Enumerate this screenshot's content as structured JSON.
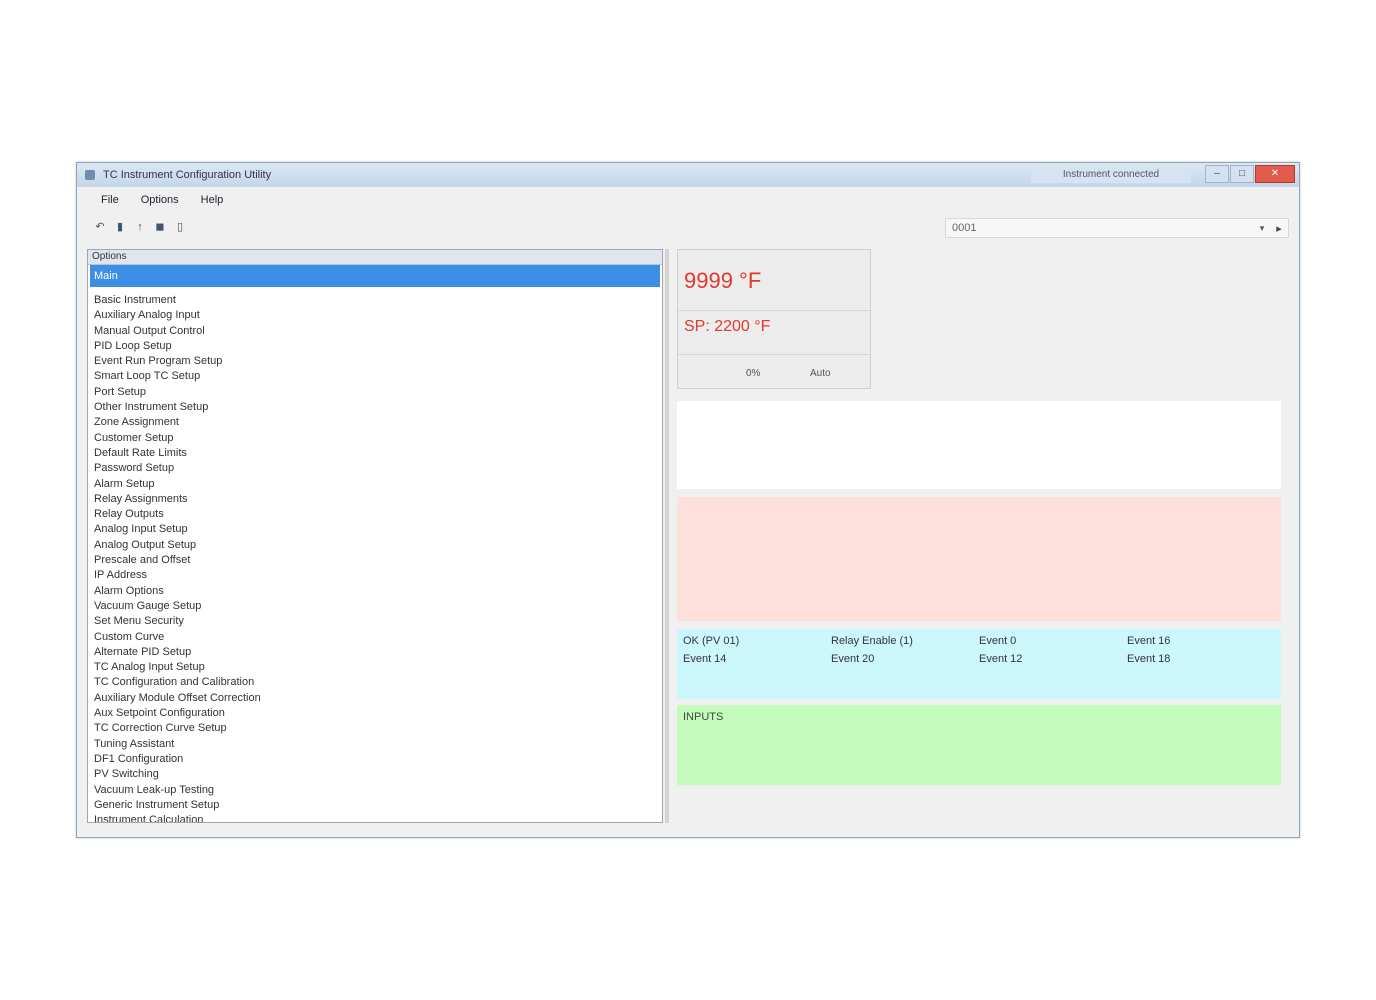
{
  "window": {
    "title": "TC Instrument Configuration Utility",
    "status_text": "Instrument connected",
    "min": "–",
    "max": "□",
    "close": "✕"
  },
  "menu": [
    "File",
    "Options",
    "Help"
  ],
  "toolbar": [
    "↶",
    "▮",
    "↑",
    "◼",
    "▯"
  ],
  "combo": {
    "value": "0001",
    "arrow": "▾",
    "go": "▸"
  },
  "list": {
    "header": "Options",
    "selected": "Main",
    "items": [
      "Basic Instrument",
      "Auxiliary Analog Input",
      "Manual Output Control",
      "PID Loop Setup",
      "Event Run Program Setup",
      "Smart Loop TC Setup",
      "Port Setup",
      "Other Instrument Setup",
      "Zone Assignment",
      "Customer Setup",
      "Default Rate Limits",
      "Password Setup",
      "Alarm Setup",
      "Relay Assignments",
      "Relay Outputs",
      "Analog Input Setup",
      "Analog Output Setup",
      "Prescale and Offset",
      "IP Address",
      "Alarm Options",
      "Vacuum Gauge Setup",
      "Set Menu Security",
      "Custom Curve",
      "Alternate PID Setup",
      "TC Analog Input Setup",
      "TC Configuration and Calibration",
      "Auxiliary Module Offset Correction",
      "Aux Setpoint Configuration",
      "TC Correction Curve Setup",
      "Tuning Assistant",
      "DF1 Configuration",
      "PV Switching",
      "Vacuum Leak-up Testing",
      "Generic Instrument Setup",
      "Instrument Calculation"
    ]
  },
  "status_box": {
    "pv": "9999 °F",
    "sp": "SP: 2200 °F",
    "out": "0%",
    "mode": "Auto"
  },
  "cyan_panel": [
    "OK (PV 01)",
    "Relay Enable (1)",
    "Event 0",
    "Event 16",
    "Event 14",
    "Event 20",
    "Event 12",
    "Event 18"
  ],
  "green_panel": {
    "label": "INPUTS"
  }
}
